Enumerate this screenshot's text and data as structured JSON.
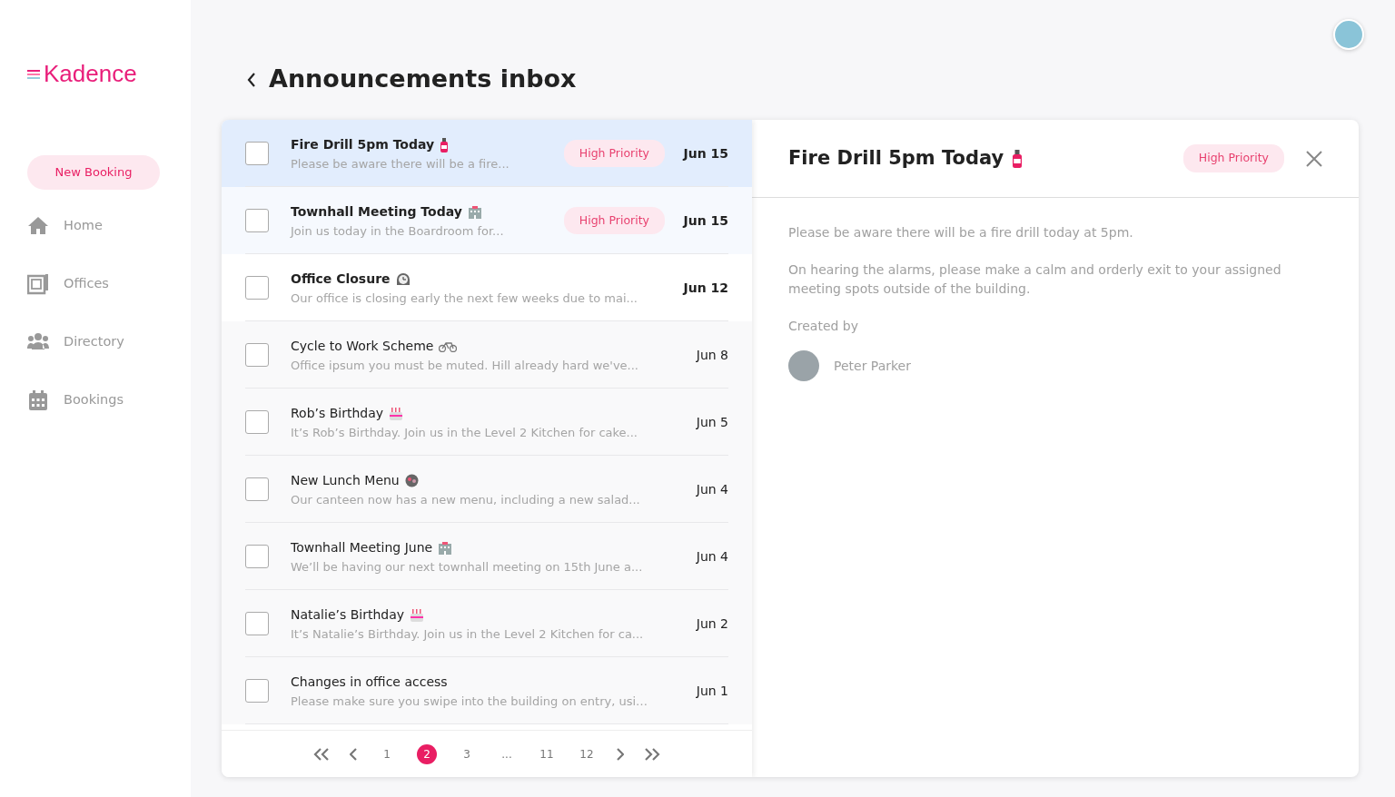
{
  "sidebar": {
    "logo": "Kadence",
    "new_booking": "New Booking",
    "items": [
      {
        "label": "Home",
        "kind": "home",
        "selected": false
      },
      {
        "label": "Offices",
        "kind": "offices",
        "selected": false
      },
      {
        "label": "Directory",
        "kind": "directory",
        "selected": false
      },
      {
        "label": "Bookings",
        "kind": "bookings",
        "selected": false
      }
    ]
  },
  "page": {
    "title": "Announcements inbox"
  },
  "list": {
    "items": [
      {
        "title": "Fire Drill 5pm Today",
        "kind": "extinguisher",
        "preview": "Please be aware there will be a fire...",
        "badge": "High Priority",
        "date": "Jun 15",
        "selected": true,
        "unread": true,
        "checked": false
      },
      {
        "title": "Townhall Meeting Today",
        "kind": "building",
        "preview": "Join us today in the Boardroom for...",
        "badge": "High Priority",
        "date": "Jun 15",
        "selected": false,
        "unread": true,
        "checked": false
      },
      {
        "title": "Office Closure",
        "kind": "clock",
        "preview": "Our office is closing early the next few weeks due to mai...",
        "date": "Jun 12",
        "selected": false,
        "unread": true,
        "checked": false
      },
      {
        "title": "Cycle to Work Scheme",
        "kind": "bicycle",
        "preview": "Office ipsum you must be muted. Hill already hard we've...",
        "date": "Jun 8",
        "selected": false,
        "unread": false,
        "checked": false
      },
      {
        "title": "Rob’s Birthday",
        "kind": "cake",
        "preview": "It’s Rob’s Birthday. Join us in the Level 2 Kitchen for cake...",
        "date": "Jun 5",
        "selected": false,
        "unread": false,
        "checked": false
      },
      {
        "title": "New Lunch Menu",
        "kind": "food",
        "preview": "Our canteen now has a new menu, including a new salad...",
        "date": "Jun 4",
        "selected": false,
        "unread": false,
        "checked": false
      },
      {
        "title": "Townhall Meeting June",
        "kind": "building",
        "preview": "We’ll be having our next townhall meeting on 15th June a...",
        "date": "Jun 4",
        "selected": false,
        "unread": false,
        "checked": false
      },
      {
        "title": "Natalie’s Birthday",
        "kind": "cake",
        "preview": "It’s Natalie’s Birthday. Join us in the Level 2 Kitchen for ca...",
        "date": "Jun 2",
        "selected": false,
        "unread": false,
        "checked": false
      },
      {
        "title": "Changes in office access",
        "kind": "plain",
        "preview": "Please make sure you swipe into the building on entry, usi…",
        "date": "Jun 1",
        "selected": false,
        "unread": false,
        "checked": false
      }
    ],
    "pagination": {
      "pages": [
        {
          "label": "1",
          "selected": false
        },
        {
          "label": "2",
          "selected": true
        },
        {
          "label": "3",
          "selected": false
        },
        {
          "label": "...",
          "selected": false
        },
        {
          "label": "11",
          "selected": false
        },
        {
          "label": "12",
          "selected": false
        }
      ]
    }
  },
  "detail": {
    "title": "Fire Drill 5pm Today",
    "kind": "extinguisher",
    "badge": "High Priority",
    "paragraphs": [
      "Please be aware there will be a fire drill today at 5pm.",
      "On hearing the alarms, please make a calm and orderly exit to your assigned meeting spots outside of the building."
    ],
    "created_by_label": "Created by",
    "author": "Peter Parker"
  }
}
